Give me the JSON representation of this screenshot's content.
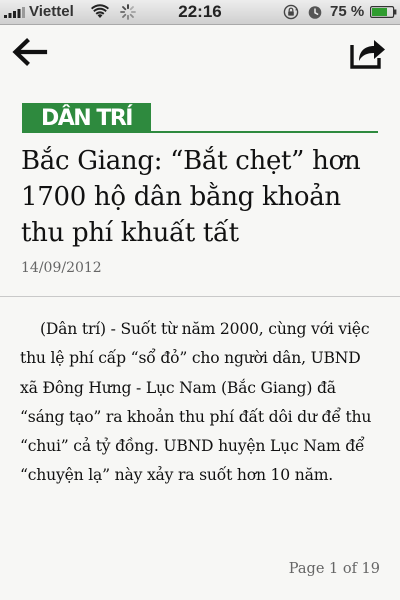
{
  "status_bar": {
    "carrier": "Viettel",
    "time": "22:16",
    "battery_percent": "75 %",
    "battery_level": 0.75,
    "icons": [
      "signal-icon",
      "wifi-icon",
      "activity-spinner-icon",
      "rotation-lock-icon",
      "alarm-icon",
      "battery-icon"
    ]
  },
  "toolbar": {
    "back_icon": "back-arrow-icon",
    "share_icon": "share-icon"
  },
  "source": {
    "logo_text": "DÂN TRÍ",
    "brand_color": "#2e8a3e"
  },
  "article": {
    "title": "Bắc Giang: “Bắt chẹt” hơn 1700 hộ dân bằng khoản thu phí khuất tất",
    "date": "14/09/2012",
    "body": "(Dân trí) - Suốt từ năm 2000, cùng với việc thu lệ phí cấp “sổ đỏ” cho người dân, UBND xã Đông Hưng - Lục Nam (Bắc Giang) đã “sáng tạo” ra khoản thu phí đất dôi dư để thu “chui” cả tỷ đồng. UBND huyện Lục Nam để “chuyện lạ” này xảy ra suốt hơn 10 năm."
  },
  "pagination": {
    "label": "Page 1 of 19",
    "current": 1,
    "total": 19
  }
}
